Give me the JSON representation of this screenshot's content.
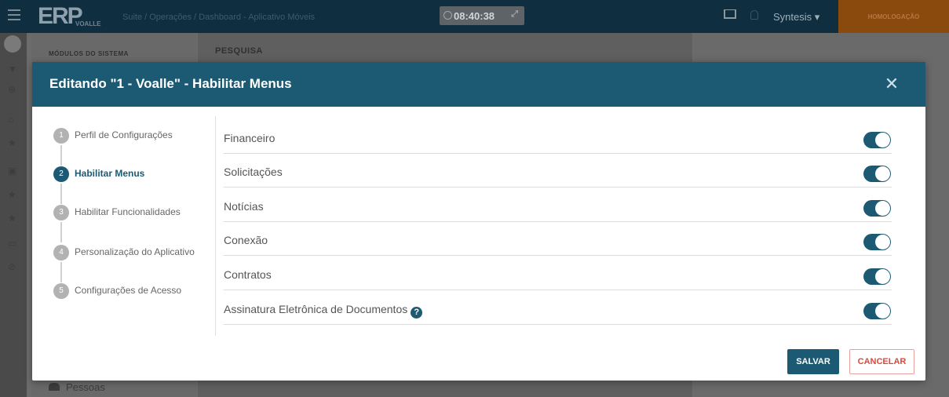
{
  "topbar": {
    "logo": "ERP",
    "logo_sub": "VOALLE",
    "breadcrumb": "Suite / Operações / Dashboard - Aplicativo Móveis",
    "clock": "08:40:38",
    "user": "Syntesis ▾",
    "environment": "HOMOLOGAÇÃO"
  },
  "modules_panel": {
    "title": "MÓDULOS DO SISTEMA",
    "pessoas": "Pessoas"
  },
  "main": {
    "title": "PESQUISA"
  },
  "modal": {
    "title": "Editando \"1 - Voalle\" - Habilitar Menus",
    "close_symbol": "✕",
    "steps": [
      {
        "num": "1",
        "label": "Perfil de Configurações",
        "active": false
      },
      {
        "num": "2",
        "label": "Habilitar Menus",
        "active": true
      },
      {
        "num": "3",
        "label": "Habilitar Funcionalidades",
        "active": false
      },
      {
        "num": "4",
        "label": "Personalização do Aplicativo",
        "active": false
      },
      {
        "num": "5",
        "label": "Configurações de Acesso",
        "active": false
      }
    ],
    "menus": [
      {
        "label": "Financeiro",
        "enabled": true
      },
      {
        "label": "Solicitações",
        "enabled": true
      },
      {
        "label": "Notícias",
        "enabled": true
      },
      {
        "label": "Conexão",
        "enabled": true
      },
      {
        "label": "Contratos",
        "enabled": true
      },
      {
        "label": "Assinatura Eletrônica de Documentos",
        "enabled": true,
        "help": "?"
      }
    ],
    "save_label": "SALVAR",
    "cancel_label": "CANCELAR"
  },
  "colors": {
    "primary": "#1c5a73",
    "cancel": "#e0463a",
    "environment_badge": "#8a4a0e"
  }
}
